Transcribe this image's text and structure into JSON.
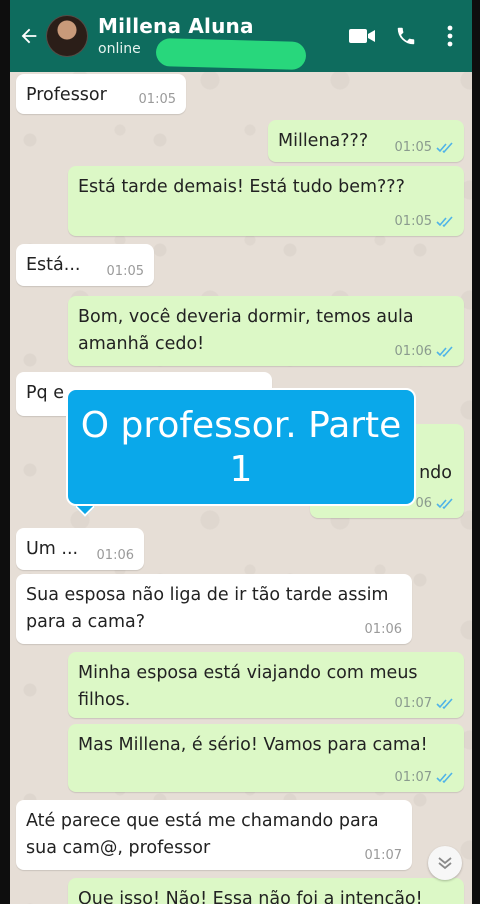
{
  "header": {
    "contact_name": "Millena Aluna",
    "status": "online",
    "icons": [
      "back-arrow-icon",
      "video-call-icon",
      "phone-icon",
      "more-options-icon"
    ]
  },
  "messages": [
    {
      "dir": "in",
      "text": "Professor",
      "time": "01:05"
    },
    {
      "dir": "out",
      "text": "Millena???",
      "time": "01:05",
      "read": true
    },
    {
      "dir": "out",
      "text": "Está tarde demais! Está tudo bem???",
      "time": "01:05",
      "read": true
    },
    {
      "dir": "in",
      "text": "Está...",
      "time": "01:05"
    },
    {
      "dir": "out",
      "text": "Bom, você deveria dormir, temos aula amanhã cedo!",
      "time": "01:06",
      "read": true
    },
    {
      "dir": "in",
      "text": "Pq e",
      "time": ""
    },
    {
      "dir": "out",
      "text": "ndo",
      "time": "06",
      "read": true
    },
    {
      "dir": "in",
      "text": "Um ...",
      "time": "01:06"
    },
    {
      "dir": "in",
      "text": "Sua esposa não liga de ir tão tarde assim para a cama?",
      "time": "01:06"
    },
    {
      "dir": "out",
      "text": "Minha esposa está viajando com meus filhos.",
      "time": "01:07",
      "read": true
    },
    {
      "dir": "out",
      "text": "Mas Millena, é sério! Vamos para cama!",
      "time": "01:07",
      "read": true
    },
    {
      "dir": "in",
      "text": "Até parece que está me chamando para sua cam@, professor",
      "time": "01:07"
    },
    {
      "dir": "out",
      "text": "Que isso! Não! Essa não foi a intenção!",
      "time": ""
    }
  ],
  "overlay": {
    "text": "O professor. Parte 1"
  },
  "colors": {
    "header_bg": "#0e6c5e",
    "outgoing_bubble": "#dcf8c6",
    "incoming_bubble": "#ffffff",
    "read_ticks": "#4fb3e8",
    "overlay_bg": "#0aa8ea",
    "status_scribble": "#28d77c"
  }
}
